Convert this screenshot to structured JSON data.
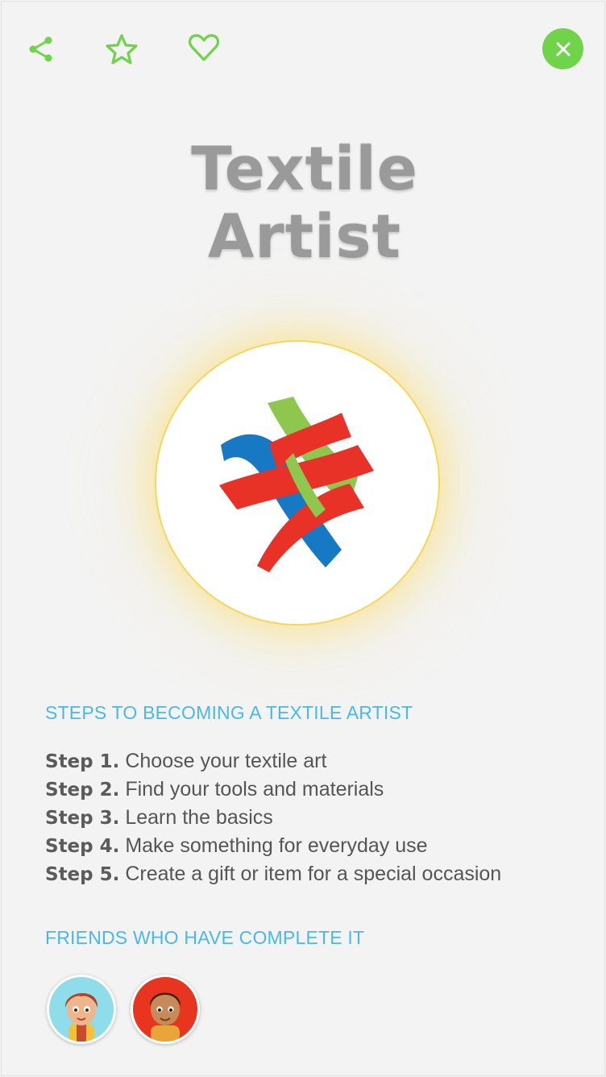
{
  "header": {
    "icons": [
      "share-icon",
      "star-icon",
      "heart-icon",
      "close-icon"
    ]
  },
  "title": {
    "line1": "Textile",
    "line2": "Artist"
  },
  "badge": {
    "icon": "woven-ribbons-logo",
    "ring_color": "#f6d65c",
    "ribbon_colors": [
      "#1778c3",
      "#e83228",
      "#8ec64e"
    ]
  },
  "steps_section": {
    "heading": "STEPS TO BECOMING A TEXTILE ARTIST",
    "steps": [
      {
        "label": "Step 1.",
        "text": " Choose your textile art"
      },
      {
        "label": "Step 2.",
        "text": "Find your tools and materials"
      },
      {
        "label": "Step 3.",
        "text": "Learn the basics"
      },
      {
        "label": "Step 4.",
        "text": "Make something for everyday use"
      },
      {
        "label": "Step 5.",
        "text": "Create a gift or item for a special occasion"
      }
    ]
  },
  "friends_section": {
    "heading": "FRIENDS WHO HAVE COMPLETE IT",
    "friends": [
      {
        "avatar": "girl-avatar",
        "bg": "#8fdcea"
      },
      {
        "avatar": "boy-avatar",
        "bg": "#e8351f"
      }
    ]
  },
  "colors": {
    "accent_green": "#6fd44a",
    "heading_blue": "#4ab9e8",
    "background": "#f3f3f3"
  }
}
